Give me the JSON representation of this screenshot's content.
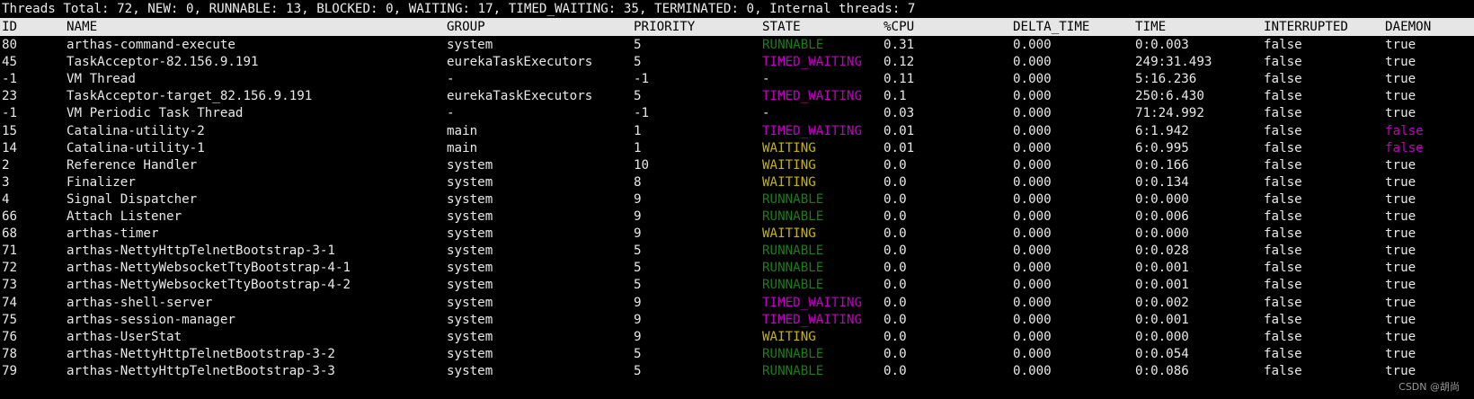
{
  "summary": "Threads Total: 72, NEW: 0, RUNNABLE: 13, BLOCKED: 0, WAITING: 17, TIMED_WAITING: 35, TERMINATED: 0, Internal threads: 7",
  "columns": {
    "id": "ID",
    "name": "NAME",
    "group": "GROUP",
    "priority": "PRIORITY",
    "state": "STATE",
    "cpu": "%CPU",
    "delta_time": "DELTA_TIME",
    "time": "TIME",
    "interrupted": "INTERRUPTED",
    "daemon": "DAEMON"
  },
  "colors": {
    "RUNNABLE": "#1d7a1d",
    "TIMED_WAITING": "#c000c0",
    "WAITING": "#c8b400",
    "daemon_false": "#c000c0",
    "header_background": "#e6e6e6",
    "terminal_background": "#000000"
  },
  "rows": [
    {
      "id": "80",
      "name": "arthas-command-execute",
      "group": "system",
      "priority": "5",
      "state": "RUNNABLE",
      "cpu": "0.31",
      "delta_time": "0.000",
      "time": "0:0.003",
      "interrupted": "false",
      "daemon": "true"
    },
    {
      "id": "45",
      "name": "TaskAcceptor-82.156.9.191",
      "group": "eurekaTaskExecutors",
      "priority": "5",
      "state": "TIMED_WAITING",
      "cpu": "0.12",
      "delta_time": "0.000",
      "time": "249:31.493",
      "interrupted": "false",
      "daemon": "true"
    },
    {
      "id": "-1",
      "name": "VM Thread",
      "group": "-",
      "priority": "-1",
      "state": "-",
      "cpu": "0.11",
      "delta_time": "0.000",
      "time": "5:16.236",
      "interrupted": "false",
      "daemon": "true"
    },
    {
      "id": "23",
      "name": "TaskAcceptor-target_82.156.9.191",
      "group": "eurekaTaskExecutors",
      "priority": "5",
      "state": "TIMED_WAITING",
      "cpu": "0.1",
      "delta_time": "0.000",
      "time": "250:6.430",
      "interrupted": "false",
      "daemon": "true"
    },
    {
      "id": "-1",
      "name": "VM Periodic Task Thread",
      "group": "-",
      "priority": "-1",
      "state": "-",
      "cpu": "0.03",
      "delta_time": "0.000",
      "time": "71:24.992",
      "interrupted": "false",
      "daemon": "true"
    },
    {
      "id": "15",
      "name": "Catalina-utility-2",
      "group": "main",
      "priority": "1",
      "state": "TIMED_WAITING",
      "cpu": "0.01",
      "delta_time": "0.000",
      "time": "6:1.942",
      "interrupted": "false",
      "daemon": "false"
    },
    {
      "id": "14",
      "name": "Catalina-utility-1",
      "group": "main",
      "priority": "1",
      "state": "WAITING",
      "cpu": "0.01",
      "delta_time": "0.000",
      "time": "6:0.995",
      "interrupted": "false",
      "daemon": "false"
    },
    {
      "id": "2",
      "name": "Reference Handler",
      "group": "system",
      "priority": "10",
      "state": "WAITING",
      "cpu": "0.0",
      "delta_time": "0.000",
      "time": "0:0.166",
      "interrupted": "false",
      "daemon": "true"
    },
    {
      "id": "3",
      "name": "Finalizer",
      "group": "system",
      "priority": "8",
      "state": "WAITING",
      "cpu": "0.0",
      "delta_time": "0.000",
      "time": "0:0.134",
      "interrupted": "false",
      "daemon": "true"
    },
    {
      "id": "4",
      "name": "Signal Dispatcher",
      "group": "system",
      "priority": "9",
      "state": "RUNNABLE",
      "cpu": "0.0",
      "delta_time": "0.000",
      "time": "0:0.000",
      "interrupted": "false",
      "daemon": "true"
    },
    {
      "id": "66",
      "name": "Attach Listener",
      "group": "system",
      "priority": "9",
      "state": "RUNNABLE",
      "cpu": "0.0",
      "delta_time": "0.000",
      "time": "0:0.006",
      "interrupted": "false",
      "daemon": "true"
    },
    {
      "id": "68",
      "name": "arthas-timer",
      "group": "system",
      "priority": "9",
      "state": "WAITING",
      "cpu": "0.0",
      "delta_time": "0.000",
      "time": "0:0.000",
      "interrupted": "false",
      "daemon": "true"
    },
    {
      "id": "71",
      "name": "arthas-NettyHttpTelnetBootstrap-3-1",
      "group": "system",
      "priority": "5",
      "state": "RUNNABLE",
      "cpu": "0.0",
      "delta_time": "0.000",
      "time": "0:0.028",
      "interrupted": "false",
      "daemon": "true"
    },
    {
      "id": "72",
      "name": "arthas-NettyWebsocketTtyBootstrap-4-1",
      "group": "system",
      "priority": "5",
      "state": "RUNNABLE",
      "cpu": "0.0",
      "delta_time": "0.000",
      "time": "0:0.001",
      "interrupted": "false",
      "daemon": "true"
    },
    {
      "id": "73",
      "name": "arthas-NettyWebsocketTtyBootstrap-4-2",
      "group": "system",
      "priority": "5",
      "state": "RUNNABLE",
      "cpu": "0.0",
      "delta_time": "0.000",
      "time": "0:0.001",
      "interrupted": "false",
      "daemon": "true"
    },
    {
      "id": "74",
      "name": "arthas-shell-server",
      "group": "system",
      "priority": "9",
      "state": "TIMED_WAITING",
      "cpu": "0.0",
      "delta_time": "0.000",
      "time": "0:0.002",
      "interrupted": "false",
      "daemon": "true"
    },
    {
      "id": "75",
      "name": "arthas-session-manager",
      "group": "system",
      "priority": "9",
      "state": "TIMED_WAITING",
      "cpu": "0.0",
      "delta_time": "0.000",
      "time": "0:0.001",
      "interrupted": "false",
      "daemon": "true"
    },
    {
      "id": "76",
      "name": "arthas-UserStat",
      "group": "system",
      "priority": "9",
      "state": "WAITING",
      "cpu": "0.0",
      "delta_time": "0.000",
      "time": "0:0.000",
      "interrupted": "false",
      "daemon": "true"
    },
    {
      "id": "78",
      "name": "arthas-NettyHttpTelnetBootstrap-3-2",
      "group": "system",
      "priority": "5",
      "state": "RUNNABLE",
      "cpu": "0.0",
      "delta_time": "0.000",
      "time": "0:0.054",
      "interrupted": "false",
      "daemon": "true"
    },
    {
      "id": "79",
      "name": "arthas-NettyHttpTelnetBootstrap-3-3",
      "group": "system",
      "priority": "5",
      "state": "RUNNABLE",
      "cpu": "0.0",
      "delta_time": "0.000",
      "time": "0:0.086",
      "interrupted": "false",
      "daemon": "true"
    }
  ],
  "watermark": "CSDN @胡尚"
}
